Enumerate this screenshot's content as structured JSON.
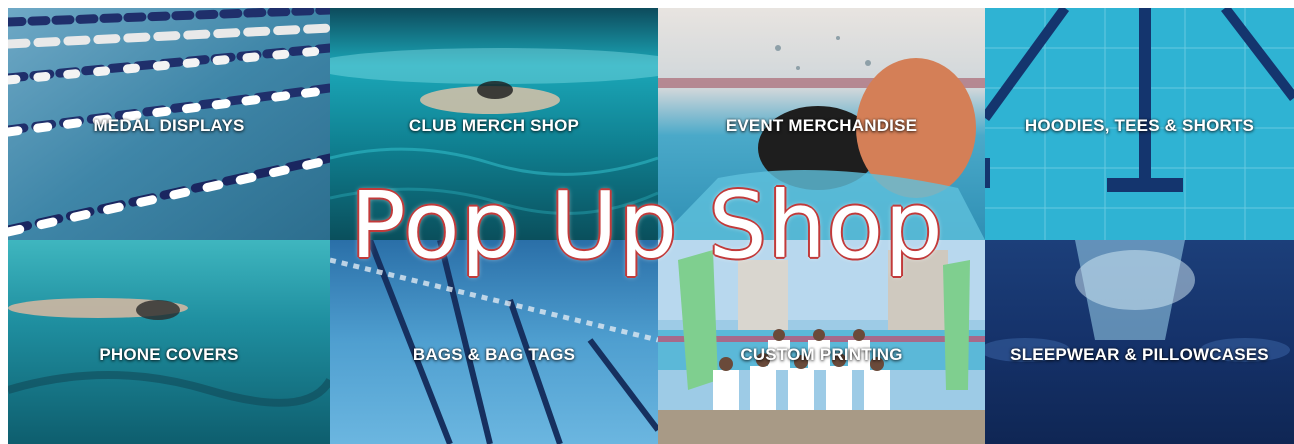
{
  "banner": {
    "overlay_title": "Pop Up Shop",
    "tiles": [
      {
        "label": "MEDAL DISPLAYS"
      },
      {
        "label": "CLUB MERCH SHOP"
      },
      {
        "label": "EVENT MERCHANDISE"
      },
      {
        "label": "HOODIES, TEES & SHORTS"
      },
      {
        "label": "PHONE COVERS"
      },
      {
        "label": "BAGS & BAG TAGS"
      },
      {
        "label": "CUSTOM PRINTING"
      },
      {
        "label": "SLEEPWEAR & PILLOWCASES"
      }
    ]
  },
  "colors": {
    "title_outline": "#c23a3a",
    "label_text": "#ffffff"
  }
}
